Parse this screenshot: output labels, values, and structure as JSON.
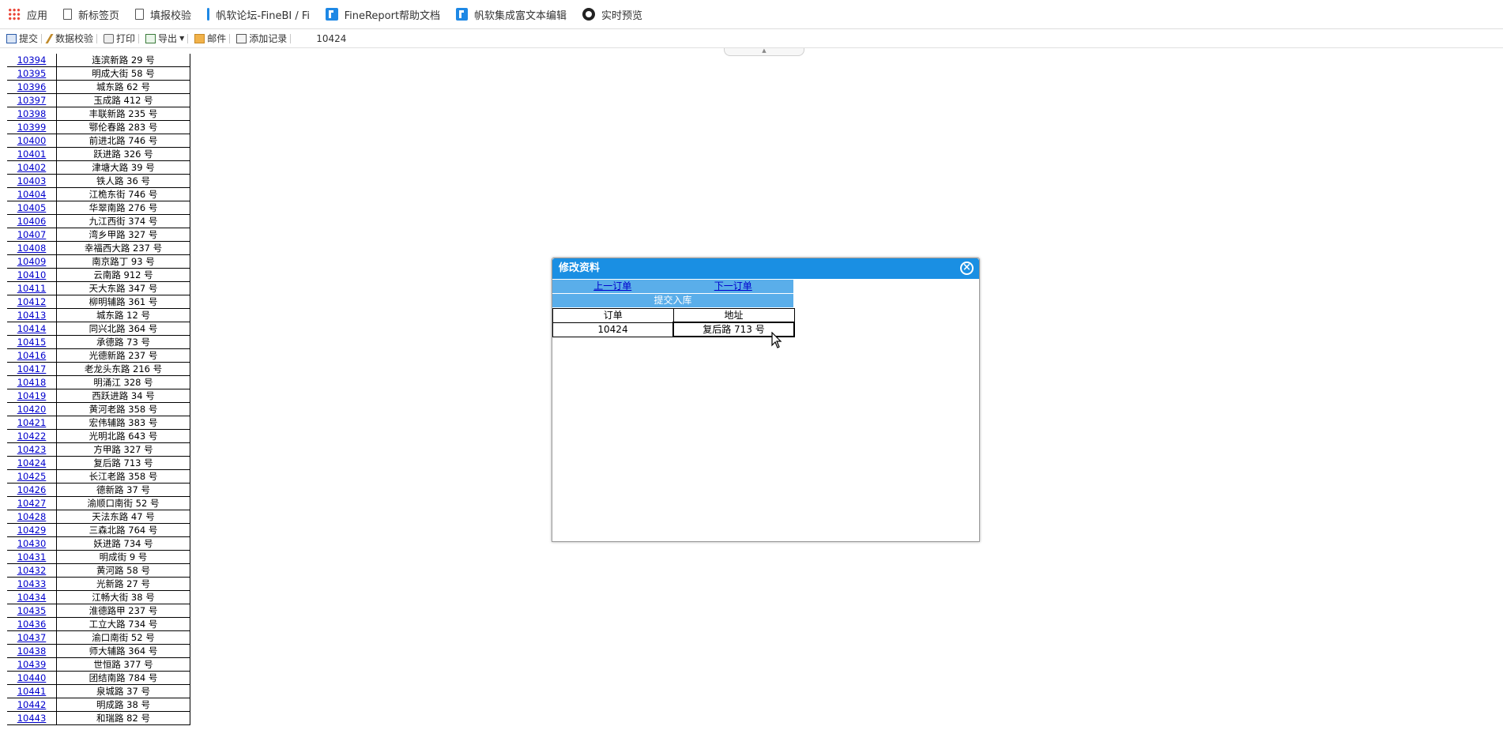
{
  "bookmarks": [
    {
      "label": "应用",
      "icon": "apps-grid-icon"
    },
    {
      "label": "新标签页",
      "icon": "page-icon"
    },
    {
      "label": "填报校验",
      "icon": "page-icon"
    },
    {
      "label": "帆软论坛-FineBI / Fi",
      "icon": "finereport-icon"
    },
    {
      "label": "FineReport帮助文档",
      "icon": "finereport-icon"
    },
    {
      "label": "帆软集成富文本编辑",
      "icon": "finereport-icon"
    },
    {
      "label": "实时预览",
      "icon": "live-preview-icon"
    }
  ],
  "toolbar": {
    "submit": "提交",
    "verify": "数据校验",
    "print": "打印",
    "export": "导出",
    "mail": "邮件",
    "add_record": "添加记录",
    "current_value": "10424"
  },
  "report_rows": [
    {
      "id": "10394",
      "address": "连滨新路 29 号"
    },
    {
      "id": "10395",
      "address": "明成大街 58 号"
    },
    {
      "id": "10396",
      "address": "城东路 62 号"
    },
    {
      "id": "10397",
      "address": "玉成路 412 号"
    },
    {
      "id": "10398",
      "address": "丰联新路 235 号"
    },
    {
      "id": "10399",
      "address": "鄂伦春路 283 号"
    },
    {
      "id": "10400",
      "address": "前进北路 746 号"
    },
    {
      "id": "10401",
      "address": "跃进路 326 号"
    },
    {
      "id": "10402",
      "address": "津塘大路 39 号"
    },
    {
      "id": "10403",
      "address": "铁人路 36 号"
    },
    {
      "id": "10404",
      "address": "江桅东街 746 号"
    },
    {
      "id": "10405",
      "address": "华翠南路 276 号"
    },
    {
      "id": "10406",
      "address": "九江西街 374 号"
    },
    {
      "id": "10407",
      "address": "湾乡甲路 327 号"
    },
    {
      "id": "10408",
      "address": "幸福西大路 237 号"
    },
    {
      "id": "10409",
      "address": "南京路丁 93 号"
    },
    {
      "id": "10410",
      "address": "云南路 912 号"
    },
    {
      "id": "10411",
      "address": "天大东路 347 号"
    },
    {
      "id": "10412",
      "address": "柳明辅路 361 号"
    },
    {
      "id": "10413",
      "address": "城东路 12 号"
    },
    {
      "id": "10414",
      "address": "同兴北路 364 号"
    },
    {
      "id": "10415",
      "address": "承德路 73 号"
    },
    {
      "id": "10416",
      "address": "光德新路 237 号"
    },
    {
      "id": "10417",
      "address": "老龙头东路 216 号"
    },
    {
      "id": "10418",
      "address": "明涌江 328 号"
    },
    {
      "id": "10419",
      "address": "西跃进路 34 号"
    },
    {
      "id": "10420",
      "address": "黄河老路 358 号"
    },
    {
      "id": "10421",
      "address": "宏伟辅路 383 号"
    },
    {
      "id": "10422",
      "address": "光明北路 643 号"
    },
    {
      "id": "10423",
      "address": "方甲路 327 号"
    },
    {
      "id": "10424",
      "address": "复后路 713 号"
    },
    {
      "id": "10425",
      "address": "长江老路 358 号"
    },
    {
      "id": "10426",
      "address": "德新路 37 号"
    },
    {
      "id": "10427",
      "address": "渝顺口南街 52 号"
    },
    {
      "id": "10428",
      "address": "天法东路 47 号"
    },
    {
      "id": "10429",
      "address": "三森北路 764 号"
    },
    {
      "id": "10430",
      "address": "妖进路 734 号"
    },
    {
      "id": "10431",
      "address": "明成街 9 号"
    },
    {
      "id": "10432",
      "address": "黄河路 58 号"
    },
    {
      "id": "10433",
      "address": "光新路 27 号"
    },
    {
      "id": "10434",
      "address": "江畅大街 38 号"
    },
    {
      "id": "10435",
      "address": "淮德路甲 237 号"
    },
    {
      "id": "10436",
      "address": "工立大路 734 号"
    },
    {
      "id": "10437",
      "address": "渝口南街 52 号"
    },
    {
      "id": "10438",
      "address": "师大辅路 364 号"
    },
    {
      "id": "10439",
      "address": "世恒路 377 号"
    },
    {
      "id": "10440",
      "address": "团结南路 784 号"
    },
    {
      "id": "10441",
      "address": "泉城路 37 号"
    },
    {
      "id": "10442",
      "address": "明成路 38 号"
    },
    {
      "id": "10443",
      "address": "和瑞路 82 号"
    }
  ],
  "dialog": {
    "title": "修改资料",
    "prev_order": "上一订单",
    "next_order": "下一订单",
    "submit_to_db": "提交入库",
    "headers": [
      "订单",
      "地址"
    ],
    "order_value": "10424",
    "address_value": "复后路 713 号"
  }
}
